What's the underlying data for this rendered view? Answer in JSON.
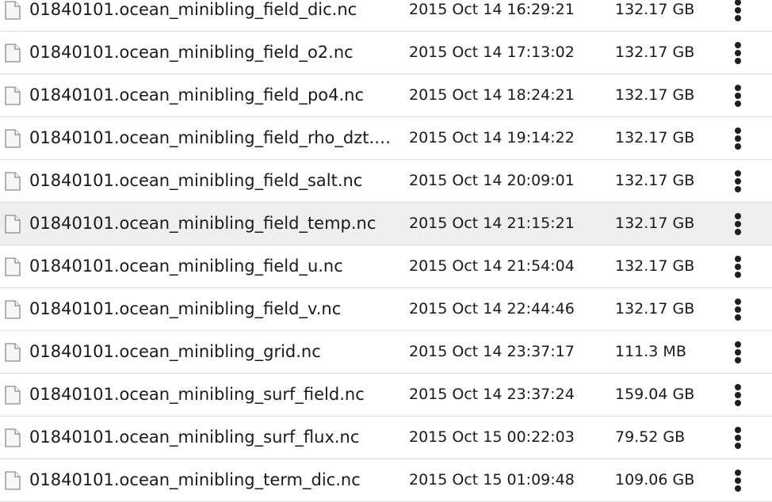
{
  "files": [
    {
      "name": "01840101.ocean_minibling_field_dic.nc",
      "date": "2015 Oct 14 16:29:21",
      "size": "132.17 GB",
      "icon": "file-icon",
      "selected": false
    },
    {
      "name": "01840101.ocean_minibling_field_o2.nc",
      "date": "2015 Oct 14 17:13:02",
      "size": "132.17 GB",
      "icon": "file-icon",
      "selected": false
    },
    {
      "name": "01840101.ocean_minibling_field_po4.nc",
      "date": "2015 Oct 14 18:24:21",
      "size": "132.17 GB",
      "icon": "file-icon",
      "selected": false
    },
    {
      "name": "01840101.ocean_minibling_field_rho_dzt.…",
      "date": "2015 Oct 14 19:14:22",
      "size": "132.17 GB",
      "icon": "file-icon",
      "selected": false
    },
    {
      "name": "01840101.ocean_minibling_field_salt.nc",
      "date": "2015 Oct 14 20:09:01",
      "size": "132.17 GB",
      "icon": "file-icon",
      "selected": false
    },
    {
      "name": "01840101.ocean_minibling_field_temp.nc",
      "date": "2015 Oct 14 21:15:21",
      "size": "132.17 GB",
      "icon": "file-icon",
      "selected": true
    },
    {
      "name": "01840101.ocean_minibling_field_u.nc",
      "date": "2015 Oct 14 21:54:04",
      "size": "132.17 GB",
      "icon": "file-icon",
      "selected": false
    },
    {
      "name": "01840101.ocean_minibling_field_v.nc",
      "date": "2015 Oct 14 22:44:46",
      "size": "132.17 GB",
      "icon": "file-icon",
      "selected": false
    },
    {
      "name": "01840101.ocean_minibling_grid.nc",
      "date": "2015 Oct 14 23:37:17",
      "size": "111.3 MB",
      "icon": "file-icon",
      "selected": false
    },
    {
      "name": "01840101.ocean_minibling_surf_field.nc",
      "date": "2015 Oct 14 23:37:24",
      "size": "159.04 GB",
      "icon": "file-icon",
      "selected": false
    },
    {
      "name": "01840101.ocean_minibling_surf_flux.nc",
      "date": "2015 Oct 15 00:22:03",
      "size": "79.52 GB",
      "icon": "file-icon",
      "selected": false
    },
    {
      "name": "01840101.ocean_minibling_term_dic.nc",
      "date": "2015 Oct 15 01:09:48",
      "size": "109.06 GB",
      "icon": "file-icon",
      "selected": false
    }
  ],
  "more_icon": "more-vertical-icon",
  "colors": {
    "text": "#1a1a1a",
    "selected_row": "#efefef",
    "divider": "#dcdcdc",
    "icon_outline": "#8a8a8a",
    "icon_fill": "#f6f6f6"
  }
}
